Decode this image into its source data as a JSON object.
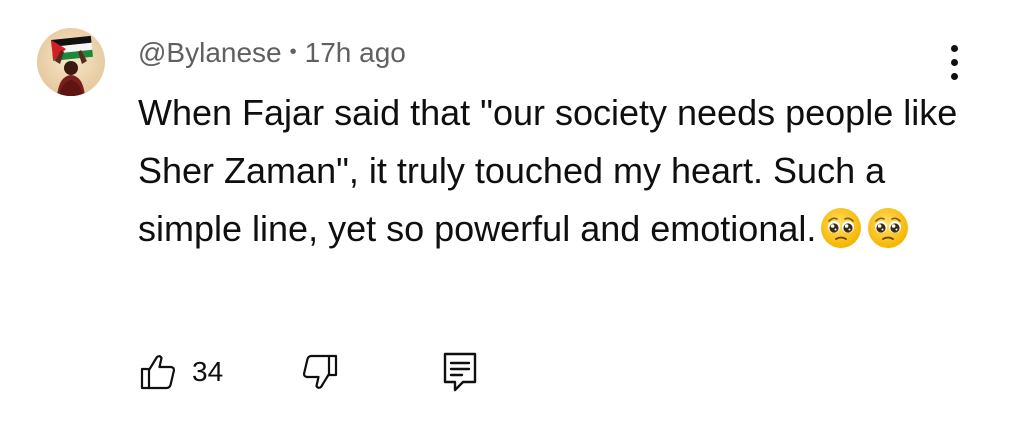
{
  "comment": {
    "author_handle": "@Bylanese",
    "separator": "•",
    "timestamp": "17h ago",
    "text": "When Fajar said that \"our society needs people like Sher Zaman\", it truly touched my heart. Such a simple line, yet so powerful and emotional.",
    "emojis": [
      "pleading-face-emoji",
      "pleading-face-emoji"
    ],
    "avatar_icon": "profile-avatar-flag",
    "menu_icon": "more-vert-icon"
  },
  "actions": {
    "like_icon": "thumbs-up-icon",
    "like_count": "34",
    "dislike_icon": "thumbs-down-icon",
    "reply_icon": "reply-comment-icon"
  },
  "colors": {
    "text_primary": "#0f0f0f",
    "text_secondary": "#606060",
    "background": "#ffffff"
  }
}
